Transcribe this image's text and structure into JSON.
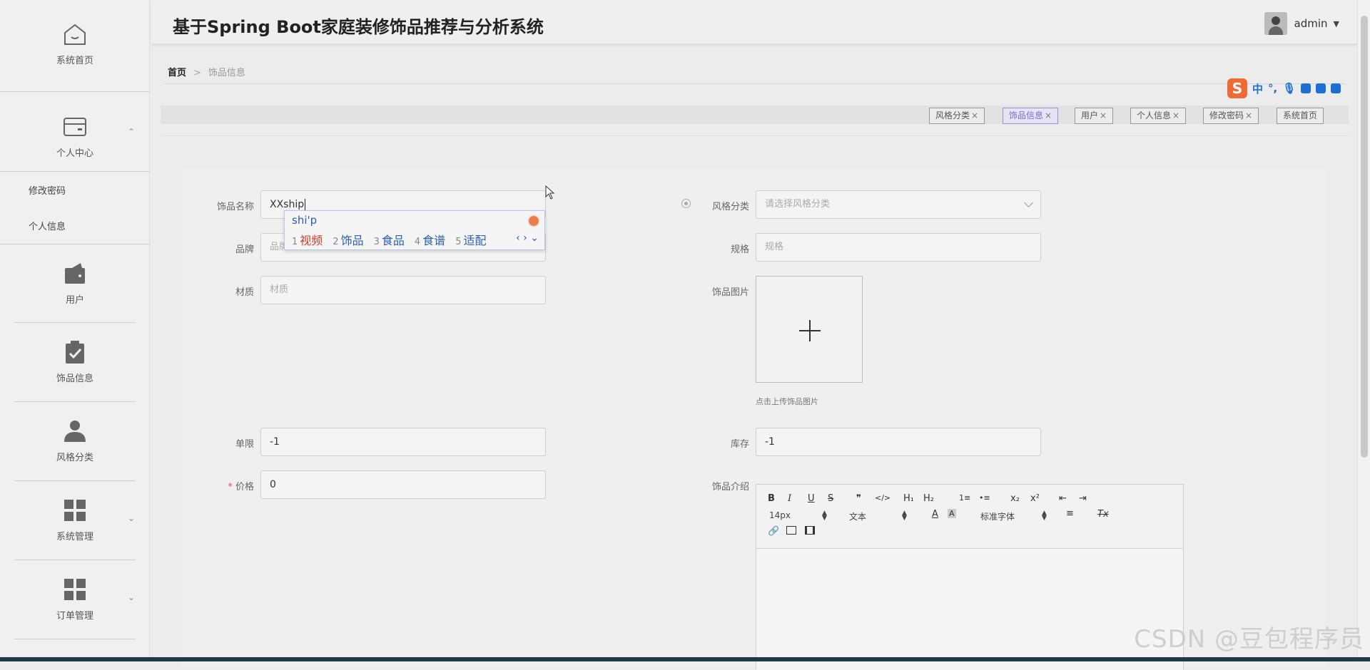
{
  "sidebar": {
    "home": "系统首页",
    "personal_center": "个人中心",
    "sub_change_password": "修改密码",
    "sub_personal_info": "个人信息",
    "user": "用户",
    "decor_info": "饰品信息",
    "style_category": "风格分类",
    "system_manage": "系统管理",
    "order_manage": "订单管理"
  },
  "header": {
    "title": "基于Spring Boot家庭装修饰品推荐与分析系统",
    "username": "admin"
  },
  "breadcrumb": {
    "home": "首页",
    "sep": ">",
    "current": "饰品信息"
  },
  "ime_bar": {
    "logo": "S",
    "mode": "中",
    "punct": "°,"
  },
  "tabs": [
    {
      "label": "风格分类",
      "active": false
    },
    {
      "label": "饰品信息",
      "active": true
    },
    {
      "label": "用户",
      "active": false
    },
    {
      "label": "个人信息",
      "active": false
    },
    {
      "label": "修改密码",
      "active": false
    },
    {
      "label": "系统首页",
      "active": false
    }
  ],
  "tab_close": "×",
  "form": {
    "name_label": "饰品名称",
    "name_value": "XXship",
    "brand_label": "品牌",
    "brand_placeholder": "品牌",
    "material_label": "材质",
    "material_placeholder": "材质",
    "style_label": "风格分类",
    "style_placeholder": "请选择风格分类",
    "spec_label": "规格",
    "spec_placeholder": "规格",
    "image_label": "饰品图片",
    "upload_tip": "点击上传饰品图片",
    "limit_label": "单限",
    "limit_value": "-1",
    "stock_label": "库存",
    "stock_value": "-1",
    "price_required": "*",
    "price_label": "价格",
    "price_value": "0",
    "intro_label": "饰品介绍"
  },
  "editor": {
    "font_size": "14px",
    "text_type": "文本",
    "font_family": "标准字体",
    "bold": "B",
    "italic": "I",
    "underline": "U",
    "strike": "S",
    "quote": "❞",
    "code": "</>",
    "h1": "H₁",
    "h2": "H₂",
    "ordered_list": "1≡",
    "bullet_list": "•≡",
    "sub": "x₂",
    "sup": "x²",
    "outdent": "⇤",
    "indent": "⇥",
    "clean": "Tx"
  },
  "ime_popup": {
    "pinyin": "shi'p",
    "candidates": [
      {
        "n": "1",
        "w": "视频"
      },
      {
        "n": "2",
        "w": "饰品"
      },
      {
        "n": "3",
        "w": "食品"
      },
      {
        "n": "4",
        "w": "食谱"
      },
      {
        "n": "5",
        "w": "适配"
      }
    ],
    "nav": "‹ › ⌄"
  },
  "watermark": "CSDN @豆包程序员"
}
